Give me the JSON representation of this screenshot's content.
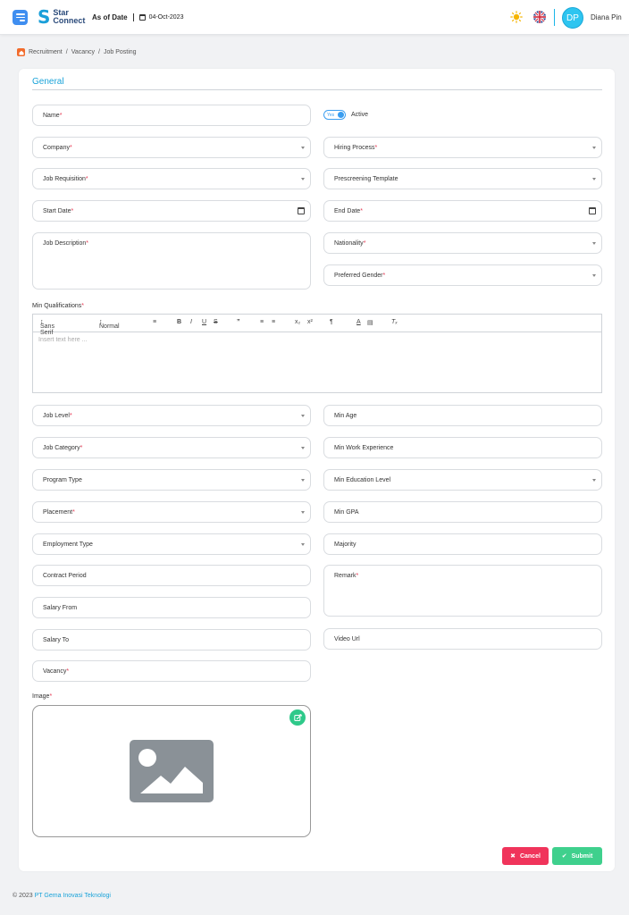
{
  "header": {
    "logo_line1": "Star",
    "logo_line2": "Connect",
    "as_of_label": "As of Date",
    "as_of_value": "04-Oct-2023",
    "avatar_initials": "DP",
    "user_name": "Diana Pin"
  },
  "breadcrumb": {
    "items": [
      "Recruitment",
      "/",
      "Vacancy",
      "/",
      "Job Posting"
    ]
  },
  "section": {
    "title": "General"
  },
  "toggle": {
    "yes_label": "Yes",
    "label": "Active"
  },
  "fields": {
    "name": "Name",
    "company": "Company",
    "hiring_process": "Hiring Process",
    "job_requisition": "Job Requisition",
    "prescreening_template": "Prescreening Template",
    "start_date": "Start Date",
    "end_date": "End Date",
    "job_description": "Job Description",
    "nationality": "Nationality",
    "preferred_gender": "Preferred Gender",
    "job_level": "Job Level",
    "min_age": "Min Age",
    "job_category": "Job Category",
    "min_work_experience": "Min Work Experience",
    "program_type": "Program Type",
    "min_education_level": "Min Education Level",
    "placement": "Placement",
    "min_gpa": "Min GPA",
    "employment_type": "Employment Type",
    "majority": "Majority",
    "contract_period": "Contract Period",
    "remark": "Remark",
    "salary_from": "Salary From",
    "salary_to": "Salary To",
    "video_url": "Video Url",
    "vacancy": "Vacancy",
    "image": "Image"
  },
  "editor": {
    "label": "Min Qualifications",
    "font": "Sans Serif",
    "size": "Normal",
    "placeholder": "Insert text here ..."
  },
  "required_mark": "*",
  "buttons": {
    "cancel": "Cancel",
    "submit": "Submit"
  },
  "footer": {
    "copyright": "© 2023",
    "company": "PT Gema Inovasi Teknologi"
  },
  "colors": {
    "accent": "#1aa3d9",
    "danger": "#f0345b",
    "success": "#3fd08d",
    "required": "#e4344f"
  }
}
